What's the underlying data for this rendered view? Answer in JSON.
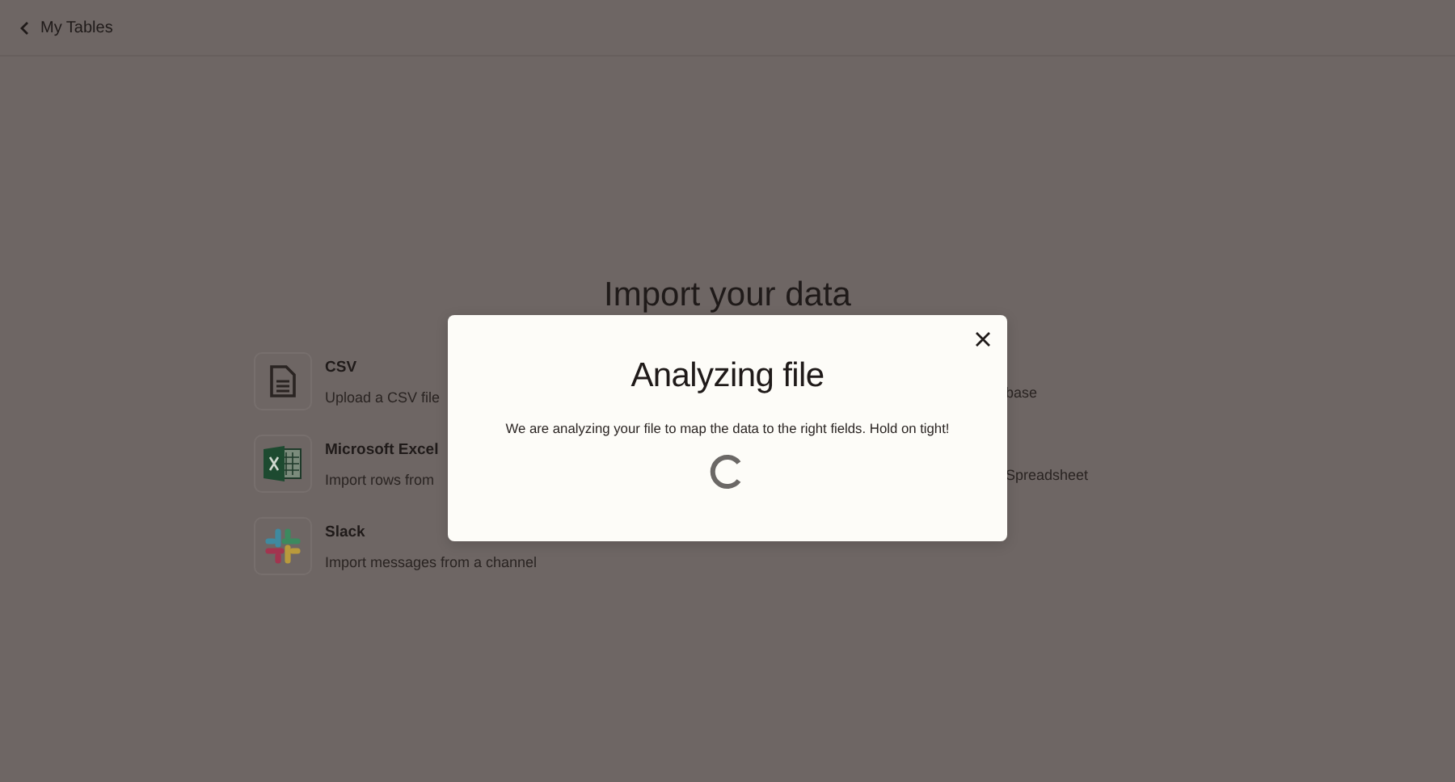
{
  "header": {
    "back_label": "My Tables"
  },
  "page": {
    "title": "Import your data",
    "sources": [
      {
        "kind": "csv",
        "name": "CSV",
        "description": "Upload a CSV file"
      },
      {
        "kind": "excel",
        "name": "Microsoft Excel",
        "description": "Import rows from"
      },
      {
        "kind": "slack",
        "name": "Slack",
        "description": "Import messages from a channel"
      }
    ],
    "right_descriptions": [
      "base",
      "Spreadsheet"
    ]
  },
  "modal": {
    "title": "Analyzing file",
    "message": "We are analyzing your file to map the data to the right fields. Hold on tight!"
  }
}
